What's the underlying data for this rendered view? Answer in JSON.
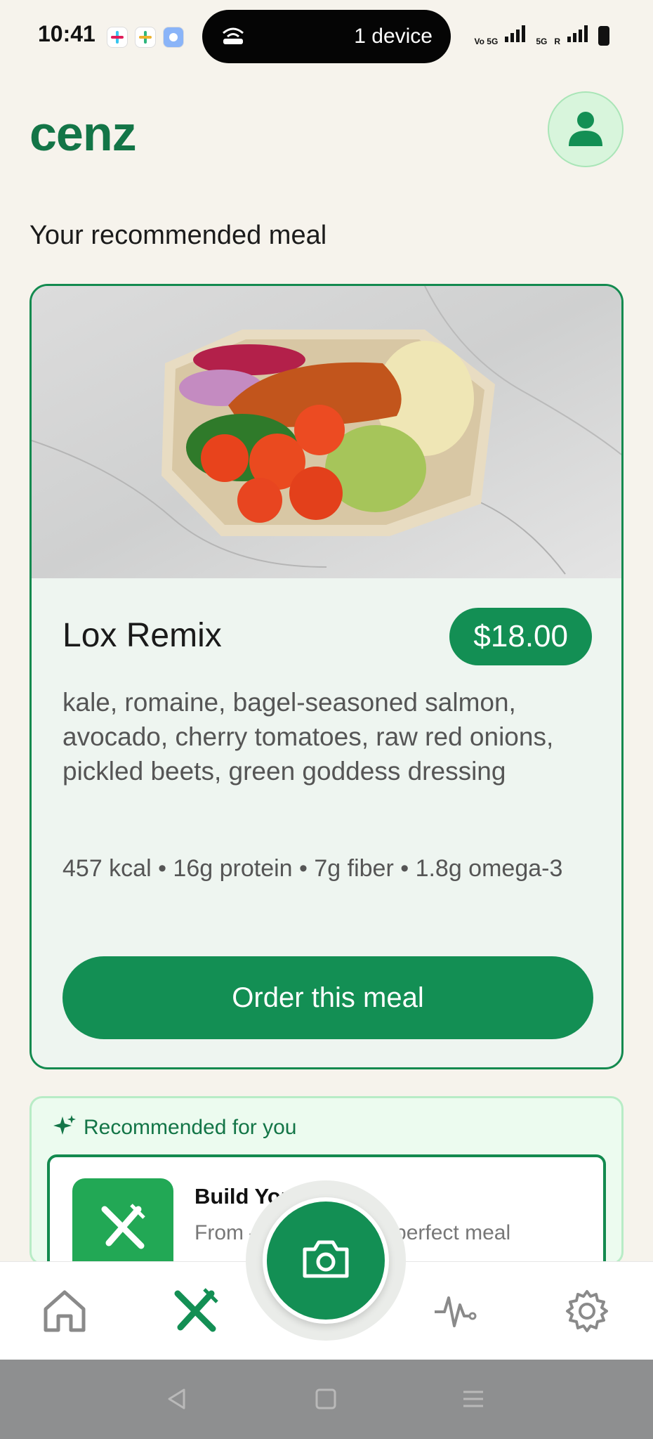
{
  "status_bar": {
    "time": "10:41",
    "pill_text": "1 device",
    "network_labels": [
      "Vo 5G",
      "5G",
      "R"
    ]
  },
  "header": {
    "brand": "cenz"
  },
  "section_title": "Your recommended meal",
  "meal": {
    "name": "Lox Remix",
    "price": "$18.00",
    "description": "kale, romaine, bagel-seasoned salmon, avocado, cherry tomatoes, raw red onions, pickled beets, green goddess dressing",
    "macros": "457 kcal • 16g protein • 7g fiber • 1.8g omega-3",
    "order_label": "Order this meal"
  },
  "recommended": {
    "title": "Recommended for you",
    "item_title": "Build Your",
    "item_desc": "From — — — e your perfect meal"
  },
  "nav": {
    "items": [
      "home-icon",
      "utensils-icon",
      "camera-icon",
      "activity-icon",
      "settings-icon"
    ],
    "active": "utensils-icon"
  },
  "colors": {
    "brand_green": "#137547",
    "accent_green": "#138f54",
    "background": "#f6f3ec"
  }
}
